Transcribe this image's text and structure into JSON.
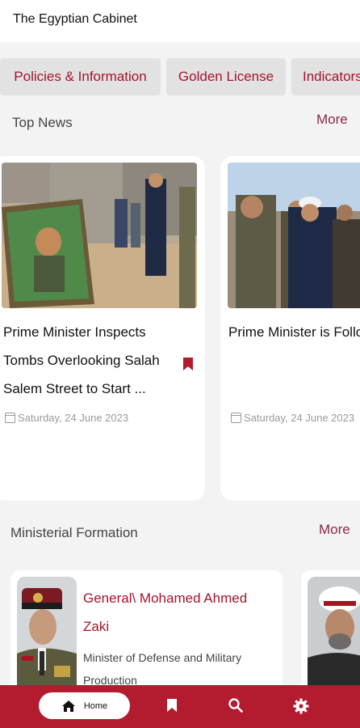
{
  "header": {
    "title": "The Egyptian Cabinet"
  },
  "categories": [
    {
      "label": "Policies & Information"
    },
    {
      "label": "Golden License"
    },
    {
      "label": "Indicators"
    }
  ],
  "top_news": {
    "title": "Top News",
    "more_label": "More",
    "items": [
      {
        "title": "Prime Minister Inspects Tombs Overlooking Salah Salem Street to Start ...",
        "date": "Saturday, 24 June 2023",
        "bookmarked": true
      },
      {
        "title": " Prime Minister is Following Progress of Project to Develop Fu",
        "date": "Saturday, 24 June 2023",
        "bookmarked": false
      }
    ]
  },
  "ministerial_formation": {
    "title": "Ministerial Formation",
    "more_label": "More",
    "items": [
      {
        "name": "General\\ Mohamed Ahmed Zaki",
        "role": "Minister of Defense and Military Production"
      },
      {
        "name": "",
        "role": ""
      }
    ]
  },
  "bottom_nav": {
    "home_label": "Home"
  },
  "colors": {
    "brand": "#b31b2f",
    "accent_text": "#a8132b",
    "chip_bg": "#e2e2e2"
  },
  "icons": [
    "home-icon",
    "bookmark-icon",
    "search-icon",
    "settings-icon",
    "calendar-icon"
  ]
}
